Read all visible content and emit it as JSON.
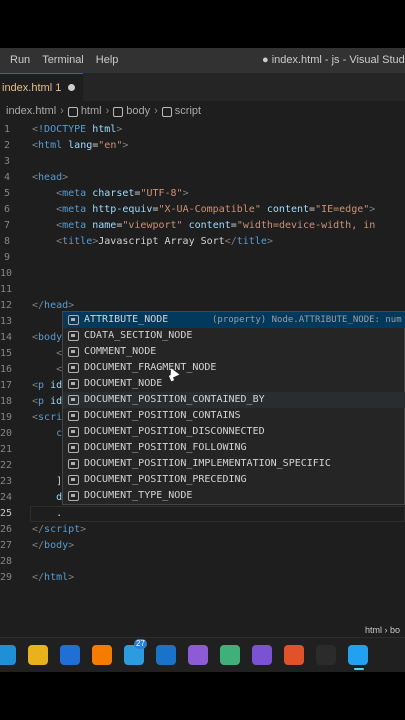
{
  "menu": {
    "items": [
      "Run",
      "Terminal",
      "Help"
    ],
    "window_title": "● index.html - js - Visual Studio"
  },
  "tab": {
    "label": "index.html 1"
  },
  "breadcrumbs": [
    "index.html",
    "html",
    "body",
    "script"
  ],
  "editor": {
    "lines": [
      {
        "n": "1",
        "html": "<span class=\"p\">&lt;</span><span class=\"t\">!DOCTYPE</span> <span class=\"a\">html</span><span class=\"p\">&gt;</span>"
      },
      {
        "n": "2",
        "html": "<span class=\"p\">&lt;</span><span class=\"t\">html</span> <span class=\"a\">lang</span>=<span class=\"s\">\"en\"</span><span class=\"p\">&gt;</span>"
      },
      {
        "n": "3",
        "html": ""
      },
      {
        "n": "4",
        "html": "<span class=\"p\">&lt;</span><span class=\"t\">head</span><span class=\"p\">&gt;</span>"
      },
      {
        "n": "5",
        "html": "    <span class=\"p\">&lt;</span><span class=\"t\">meta</span> <span class=\"a\">charset</span>=<span class=\"s\">\"UTF-8\"</span><span class=\"p\">&gt;</span>"
      },
      {
        "n": "6",
        "html": "    <span class=\"p\">&lt;</span><span class=\"t\">meta</span> <span class=\"a\">http-equiv</span>=<span class=\"s\">\"X-UA-Compatible\"</span> <span class=\"a\">content</span>=<span class=\"s\">\"IE=edge\"</span><span class=\"p\">&gt;</span>"
      },
      {
        "n": "7",
        "html": "    <span class=\"p\">&lt;</span><span class=\"t\">meta</span> <span class=\"a\">name</span>=<span class=\"s\">\"viewport\"</span> <span class=\"a\">content</span>=<span class=\"s\">\"width=device-width, in</span>"
      },
      {
        "n": "8",
        "html": "    <span class=\"p\">&lt;</span><span class=\"t\">title</span><span class=\"p\">&gt;</span>Javascript Array Sort<span class=\"p\">&lt;/</span><span class=\"t\">title</span><span class=\"p\">&gt;</span>"
      },
      {
        "n": "9",
        "html": ""
      },
      {
        "n": "10",
        "html": ""
      },
      {
        "n": "11",
        "html": ""
      },
      {
        "n": "12",
        "html": "<span class=\"p\">&lt;/</span><span class=\"t\">head</span><span class=\"p\">&gt;</span>"
      },
      {
        "n": "13",
        "html": ""
      },
      {
        "n": "14",
        "html": "<span class=\"p\">&lt;</span><span class=\"t\">body</span>"
      },
      {
        "n": "15",
        "html": "    <span class=\"p\">&lt;</span>"
      },
      {
        "n": "16",
        "html": "    <span class=\"p\">&lt;</span>"
      },
      {
        "n": "17",
        "html": "<span class=\"p\">&lt;</span><span class=\"t\">p</span> <span class=\"a\">id</span>"
      },
      {
        "n": "18",
        "html": "<span class=\"p\">&lt;</span><span class=\"t\">p</span> <span class=\"a\">id</span>"
      },
      {
        "n": "19",
        "html": "<span class=\"p\">&lt;</span><span class=\"t\">scri</span>"
      },
      {
        "n": "20",
        "html": "    <span class=\"t\">c</span>"
      },
      {
        "n": "21",
        "html": ""
      },
      {
        "n": "22",
        "html": ""
      },
      {
        "n": "23",
        "html": "    ]"
      },
      {
        "n": "24",
        "html": "    <span class=\"a\">d</span>"
      },
      {
        "n": "25",
        "html": "    ."
      },
      {
        "n": "26",
        "html": "<span class=\"p\">&lt;/</span><span class=\"t\">script</span><span class=\"p\">&gt;</span>"
      },
      {
        "n": "27",
        "html": "<span class=\"p\">&lt;/</span><span class=\"t\">body</span><span class=\"p\">&gt;</span>"
      },
      {
        "n": "28",
        "html": ""
      },
      {
        "n": "29",
        "html": "<span class=\"p\">&lt;/</span><span class=\"t\">html</span><span class=\"p\">&gt;</span>"
      }
    ],
    "current_line": "25"
  },
  "suggestions": {
    "items": [
      {
        "label": "ATTRIBUTE_NODE",
        "detail": "(property) Node.ATTRIBUTE_NODE: num",
        "selected": true
      },
      {
        "label": "CDATA_SECTION_NODE"
      },
      {
        "label": "COMMENT_NODE"
      },
      {
        "label": "DOCUMENT_FRAGMENT_NODE"
      },
      {
        "label": "DOCUMENT_NODE"
      },
      {
        "label": "DOCUMENT_POSITION_CONTAINED_BY",
        "hovered": true
      },
      {
        "label": "DOCUMENT_POSITION_CONTAINS"
      },
      {
        "label": "DOCUMENT_POSITION_DISCONNECTED"
      },
      {
        "label": "DOCUMENT_POSITION_FOLLOWING"
      },
      {
        "label": "DOCUMENT_POSITION_IMPLEMENTATION_SPECIFIC"
      },
      {
        "label": "DOCUMENT_POSITION_PRECEDING"
      },
      {
        "label": "DOCUMENT_TYPE_NODE"
      }
    ]
  },
  "status": {
    "right_text": "html › bo"
  },
  "taskbar": {
    "apps": [
      {
        "name": "edge-icon",
        "color": "#1f8fd6"
      },
      {
        "name": "chrome-icon",
        "color": "#e8b21c"
      },
      {
        "name": "store-icon",
        "color": "#1f6fd6"
      },
      {
        "name": "xampp-icon",
        "color": "#f57c00"
      },
      {
        "name": "people-icon",
        "color": "#2d9be0",
        "badge": "27"
      },
      {
        "name": "mail-icon",
        "color": "#1a73c8"
      },
      {
        "name": "visual-studio-icon",
        "color": "#8e5bd6"
      },
      {
        "name": "tools-icon",
        "color": "#3fb07a"
      },
      {
        "name": "vs-purple-icon",
        "color": "#7b52d1"
      },
      {
        "name": "brave-icon",
        "color": "#e0522a"
      },
      {
        "name": "terminal-icon",
        "color": "#2b2b2b"
      },
      {
        "name": "vscode-icon",
        "color": "#22a1f0",
        "active": true
      }
    ]
  }
}
